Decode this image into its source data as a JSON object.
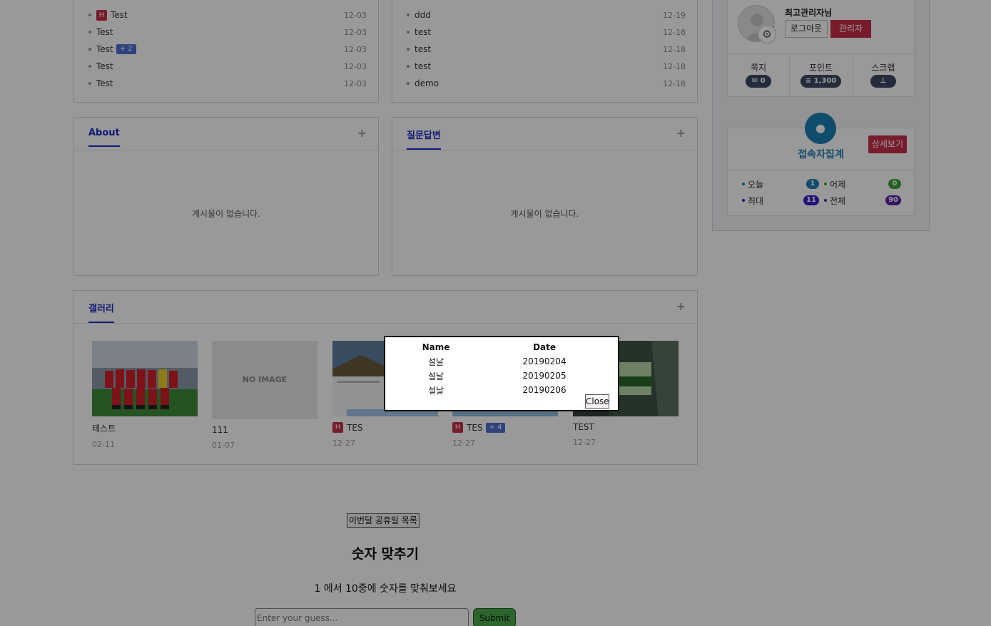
{
  "left_list": {
    "items": [
      {
        "label": "Test",
        "date": "12-03",
        "hot": "H",
        "extra": ""
      },
      {
        "label": "Test",
        "date": "12-03",
        "hot": "",
        "extra": ""
      },
      {
        "label": "Test",
        "date": "12-03",
        "hot": "",
        "extra": "+ 2"
      },
      {
        "label": "Test",
        "date": "12-03",
        "hot": "",
        "extra": ""
      },
      {
        "label": "Test",
        "date": "12-03",
        "hot": "",
        "extra": ""
      }
    ]
  },
  "right_list": {
    "items": [
      {
        "label": "ddd",
        "date": "12-19"
      },
      {
        "label": "test",
        "date": "12-18"
      },
      {
        "label": "test",
        "date": "12-18"
      },
      {
        "label": "test",
        "date": "12-18"
      },
      {
        "label": "demo",
        "date": "12-18"
      }
    ]
  },
  "about": {
    "title": "About",
    "plus": "+",
    "empty": "게시물이 없습니다."
  },
  "qna": {
    "title": "질문답변",
    "plus": "+",
    "empty": "게시물이 없습니다."
  },
  "gallery": {
    "title": "갤러리",
    "plus": "+",
    "no_image": "NO IMAGE",
    "items": [
      {
        "title": "테스트",
        "date": "02-11",
        "hot": "",
        "extra": ""
      },
      {
        "title": "111",
        "date": "01-07",
        "hot": "",
        "extra": ""
      },
      {
        "title": "TES",
        "date": "12-27",
        "hot": "H",
        "extra": ""
      },
      {
        "title": "TES",
        "date": "12-27",
        "hot": "H",
        "extra": "+ 4"
      },
      {
        "title": "TEST",
        "date": "12-27",
        "hot": "",
        "extra": ""
      }
    ]
  },
  "profile": {
    "name": "최고관리자님",
    "logout": "로그아웃",
    "admin": "관리자",
    "stats": [
      {
        "label": "쪽지",
        "value": "0",
        "icon": "envelope-icon"
      },
      {
        "label": "포인트",
        "value": "1,300",
        "icon": "database-icon"
      },
      {
        "label": "스크랩",
        "value": "",
        "icon": "pin-icon"
      }
    ]
  },
  "visitors": {
    "title": "접속자집계",
    "detail": "상세보기",
    "rows": [
      {
        "label": "오늘",
        "value": "1",
        "color": "#1c7fb2"
      },
      {
        "label": "어제",
        "value": "0",
        "color": "#3aa63a"
      },
      {
        "label": "최대",
        "value": "11",
        "color": "#3b1fc9"
      },
      {
        "label": "전체",
        "value": "90",
        "color": "#5a24a6"
      }
    ]
  },
  "holiday_button": "이번달 공휴일 목록",
  "game": {
    "title": "숫자 맞추기",
    "subtitle": "1 에서 10중에 숫자를 맞춰보세요",
    "input_placeholder": "Enter your guess...",
    "submit": "Submit"
  },
  "modal": {
    "headers": [
      "Name",
      "Date"
    ],
    "rows": [
      [
        "설날",
        "20190204"
      ],
      [
        "설날",
        "20190205"
      ],
      [
        "설날",
        "20190206"
      ]
    ],
    "close": "Close"
  }
}
